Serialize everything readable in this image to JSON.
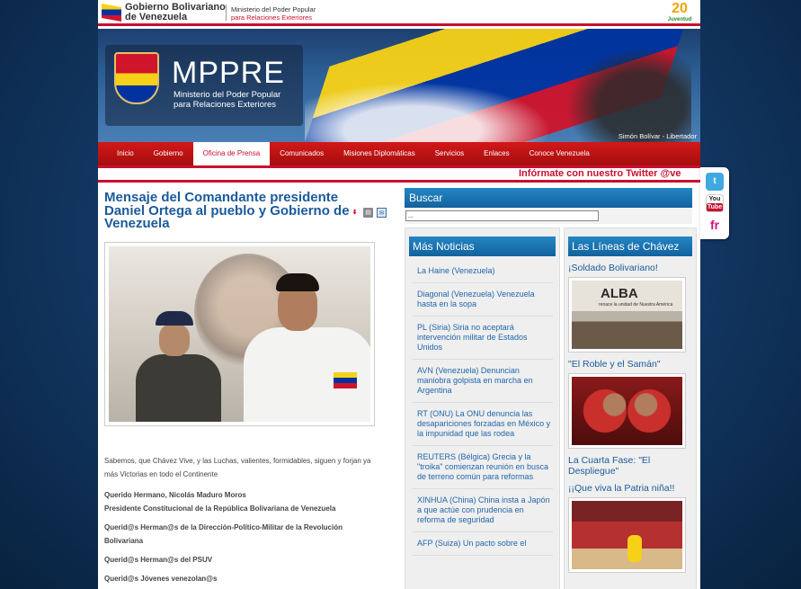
{
  "topbar": {
    "gov_line1": "Gobierno Bolivariano",
    "gov_line2": "de Venezuela",
    "ministry_line1": "Ministerio del Poder Popular",
    "ministry_line2": "para Relaciones Exteriores",
    "juventud": "20",
    "juventud_label": "Juventud"
  },
  "banner": {
    "title": "MPPRE",
    "subtitle_line1": "Ministerio del Poder Popular",
    "subtitle_line2": "para Relaciones Exteriores",
    "caption": "Simón Bolívar - Libertador"
  },
  "nav": [
    {
      "label": "Inicio"
    },
    {
      "label": "Gobierno"
    },
    {
      "label": "Oficina de Prensa",
      "active": true
    },
    {
      "label": "Comunicados"
    },
    {
      "label": "Misiones Diplomáticas"
    },
    {
      "label": "Servicios"
    },
    {
      "label": "Enlaces"
    },
    {
      "label": "Conoce Venezuela"
    }
  ],
  "ticker": "Infórmate con nuestro Twitter @ve",
  "article": {
    "title": "Mensaje del Comandante presidente Daniel Ortega al pueblo y Gobierno de Venezuela",
    "icons": [
      "pdf-icon",
      "print-icon",
      "email-icon"
    ],
    "body": [
      {
        "text": "Sabemos, que Chávez Vive, y las Luchas, valientes, formidables, siguen y forjan ya más Victorias en todo el Continente",
        "bold": false
      },
      {
        "text": "Querido Hermano, Nicolás Maduro Moros",
        "bold": true
      },
      {
        "text": "Presidente Constitucional de la República Bolivariana de Venezuela",
        "bold": true
      },
      {
        "text": "Querid@s Herman@s de la Dirección-Político-Militar de la Revolución Bolivariana",
        "bold": true
      },
      {
        "text": "Querid@s Herman@s del PSUV",
        "bold": true
      },
      {
        "text": "Querid@s Jóvenes venezolan@s",
        "bold": true
      }
    ]
  },
  "search": {
    "heading": "Buscar",
    "value": "..."
  },
  "noticias": {
    "heading": "Más Noticias",
    "items": [
      "La Haine (Venezuela)",
      "Diagonal (Venezuela) Venezuela hasta en la sopa",
      "PL (Siria) Siria no aceptará intervención militar de Estados Unidos",
      "AVN (Venezuela) Denuncian maniobra golpista en marcha en Argentina",
      "RT (ONU) La ONU denuncia las desapariciones forzadas en México y la impunidad que las rodea",
      "REUTERS (Bélgica) Grecia y la \"troika\" comienzan reunión en busca de terreno común para reformas",
      "XINHUA (China) China insta a Japón a que actúe con prudencia en reforma de seguridad",
      "AFP (Suiza) Un pacto sobre el"
    ]
  },
  "lineas": {
    "heading": "Las Líneas de Chávez",
    "items": [
      {
        "title": "¡Soldado Bolivariano!",
        "image_text": "ALBA",
        "image_sub": "renace la unidad de Nuestra América"
      },
      {
        "title": "\"El Roble y el Samán\""
      },
      {
        "title": "La Cuarta Fase: \"El Despliegue\""
      },
      {
        "title": "¡¡Que viva la Patria niña!!"
      }
    ]
  },
  "social": {
    "twitter": "t",
    "youtube_top": "You",
    "youtube_bottom": "Tube",
    "flickr": "fr"
  }
}
